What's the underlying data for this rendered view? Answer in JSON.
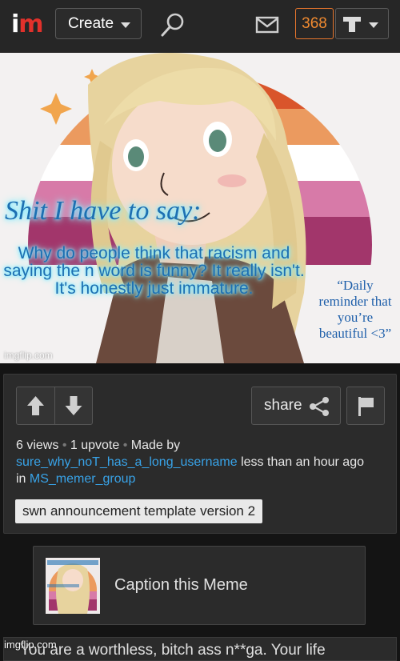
{
  "header": {
    "logo_i": "i",
    "logo_m": "m",
    "create_label": "Create",
    "notification_count": "368",
    "icons": [
      "search-icon",
      "mail-icon",
      "shirt-icon",
      "chevron-down-icon"
    ]
  },
  "meme": {
    "title": "Shit I have to say:",
    "body": "Why do people think that racism and saying the n word is funny? It really isn't. It's honestly just immature.",
    "quote": "“Daily reminder that you’re beautiful <3”",
    "watermark": "imgflip.com"
  },
  "post": {
    "views": "6 views",
    "upvotes": "1 upvote",
    "made_by_label": "Made by",
    "author": "sure_why_noT_has_a_long_username",
    "time": "less than an hour ago",
    "in_label": "in",
    "group": "MS_memer_group",
    "share_label": "share",
    "template": "swn announcement template version 2"
  },
  "caption_card": {
    "label": "Caption this Meme"
  },
  "comment": {
    "text": "You are a worthless, bitch ass n**ga. Your life",
    "watermark": "imgflip.com"
  },
  "colors": {
    "accent_orange": "#f08a30",
    "link_blue": "#38a3e8",
    "logo_red": "#e2312b",
    "meme_text_blue": "#1d6fb2",
    "meme_glow": "#7fe9ff"
  }
}
